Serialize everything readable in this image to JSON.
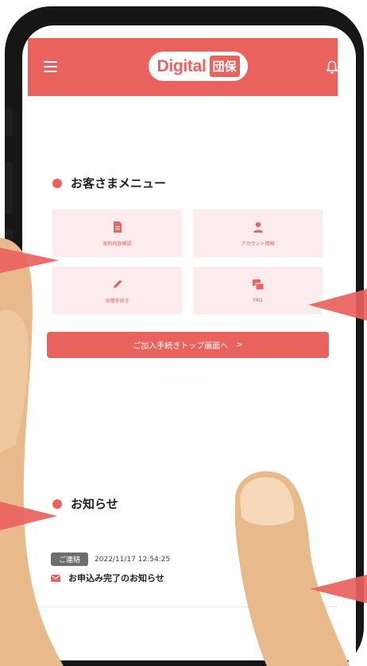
{
  "header": {
    "logo_text": "Digital",
    "logo_badge": "団保"
  },
  "menu": {
    "title": "お客さまメニュー",
    "items": [
      {
        "label": "契約内容確認",
        "icon": "document-icon"
      },
      {
        "label": "アカウント情報",
        "icon": "user-icon"
      },
      {
        "label": "各種手続き",
        "icon": "pencil-icon"
      },
      {
        "label": "FAQ",
        "icon": "faq-icon"
      }
    ],
    "cta_label": "ご加入手続きトップ画面へ",
    "cta_chevron": ">"
  },
  "news": {
    "title": "お知らせ",
    "items": [
      {
        "badge": "ご連絡",
        "date": "2022/11/17 12:54:25",
        "text": "お申込み完了のお知らせ"
      }
    ]
  },
  "colors": {
    "accent": "#e9625e",
    "tile_bg": "#fcecee",
    "badge_bg": "#6d6d6d",
    "skin": "#e8b98a"
  }
}
